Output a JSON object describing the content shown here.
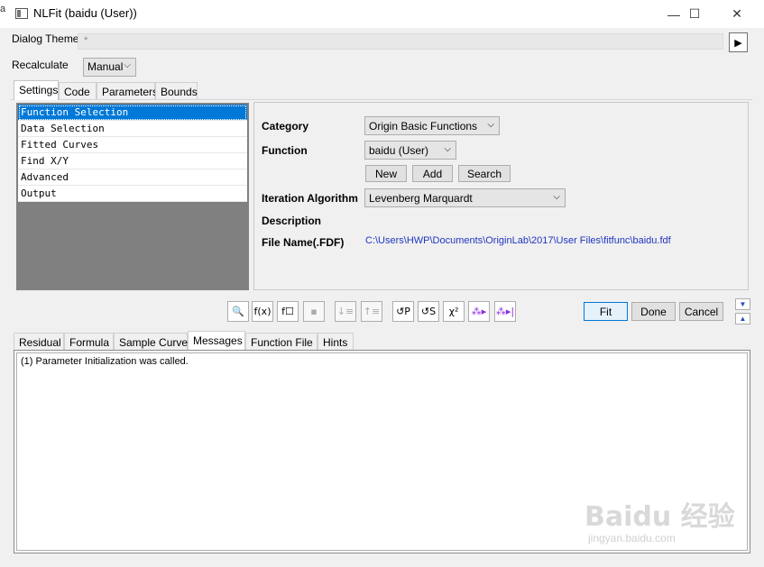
{
  "window": {
    "title": "NLFit (baidu (User))",
    "controls": {
      "minimize": "—",
      "maximize": "☐",
      "close": "✕"
    },
    "edge_fragment": "a"
  },
  "theme": {
    "label": "Dialog Theme",
    "value": "*",
    "next_button": "▶"
  },
  "recalculate": {
    "label": "Recalculate",
    "value": "Manual"
  },
  "tabs": [
    {
      "label": "Settings",
      "active": true
    },
    {
      "label": "Code",
      "active": false
    },
    {
      "label": "Parameters",
      "active": false
    },
    {
      "label": "Bounds",
      "active": false
    }
  ],
  "settings_list": [
    {
      "label": "Function Selection",
      "selected": true
    },
    {
      "label": "Data Selection",
      "selected": false
    },
    {
      "label": "Fitted Curves",
      "selected": false
    },
    {
      "label": "Find X/Y",
      "selected": false
    },
    {
      "label": "Advanced",
      "selected": false
    },
    {
      "label": "Output",
      "selected": false
    }
  ],
  "form": {
    "category_label": "Category",
    "category_value": "Origin Basic Functions",
    "function_label": "Function",
    "function_value": "baidu (User)",
    "new_button": "New",
    "add_button": "Add",
    "search_button": "Search",
    "iteration_label": "Iteration Algorithm",
    "iteration_value": "Levenberg Marquardt",
    "description_label": "Description",
    "filename_label": "File Name(.FDF)",
    "filename_value": "C:\\Users\\HWP\\Documents\\OriginLab\\2017\\User Files\\fitfunc\\baidu.fdf"
  },
  "toolbar": {
    "icons": [
      {
        "name": "find-icon",
        "glyph": "🔍"
      },
      {
        "name": "fx-icon",
        "glyph": "f(x)"
      },
      {
        "name": "function-builder-icon",
        "glyph": "f☐"
      },
      {
        "name": "save-icon",
        "glyph": "▪"
      },
      {
        "name": "sort-down-icon",
        "glyph": "↓≡"
      },
      {
        "name": "sort-up-icon",
        "glyph": "↑≡"
      },
      {
        "name": "parameter-init-icon",
        "glyph": "↺P"
      },
      {
        "name": "simplex-icon",
        "glyph": "↺S"
      },
      {
        "name": "chi-square-icon",
        "glyph": "χ²"
      },
      {
        "name": "one-iteration-icon",
        "glyph": "⁂▸"
      },
      {
        "name": "fit-till-converged-icon",
        "glyph": "⁂▸|"
      }
    ],
    "fit": "Fit",
    "done": "Done",
    "cancel": "Cancel",
    "collapse": "▼",
    "expand": "▲"
  },
  "bottom_tabs": [
    {
      "label": "Residual",
      "active": false
    },
    {
      "label": "Formula",
      "active": false
    },
    {
      "label": "Sample Curve",
      "active": false
    },
    {
      "label": "Messages",
      "active": true
    },
    {
      "label": "Function File",
      "active": false
    },
    {
      "label": "Hints",
      "active": false
    }
  ],
  "messages": {
    "text": "(1) Parameter Initialization was called."
  },
  "watermark": {
    "text": "Baidu 经验",
    "sub": "jingyan.baidu.com"
  }
}
